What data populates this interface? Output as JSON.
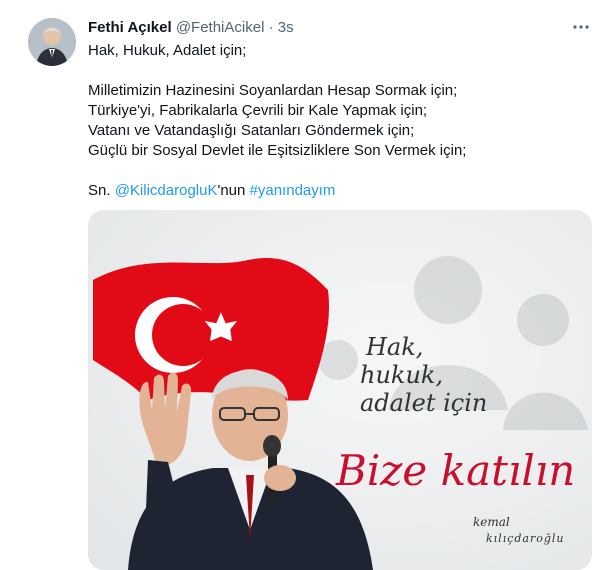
{
  "tweet": {
    "author_name": "Fethi Açıkel",
    "author_handle": "@FethiAcikel",
    "separator": "·",
    "time": "3s",
    "more_icon": "more-horizontal-icon",
    "lines": {
      "l1": "Hak, Hukuk, Adalet için;",
      "l2": "Milletimizin Hazinesini Soyanlardan Hesap Sormak için;",
      "l3": "Türkiye'yi, Fabrikalarla Çevrili bir Kale Yapmak için;",
      "l4": "Vatanı ve Vatandaşlığı Satanları Göndermek için;",
      "l5": "Güçlü bir Sosyal Devlet ile Eşitsizliklere Son Vermek için;"
    },
    "final_prefix": "Sn. ",
    "mention": "@KilicdarogluK",
    "final_mid": "'nun ",
    "hashtag": "#yanındayım",
    "link_color": "#1d9bf0"
  },
  "media": {
    "poster_line1": "Hak,",
    "poster_line2": "hukuk,",
    "poster_line3": "adalet için",
    "poster_headline": "Bize katılın",
    "signature_line1": "kemal",
    "signature_line2": "kılıçdaroğlu",
    "flag_color": "#e30a17",
    "headline_color": "#c8102e"
  }
}
